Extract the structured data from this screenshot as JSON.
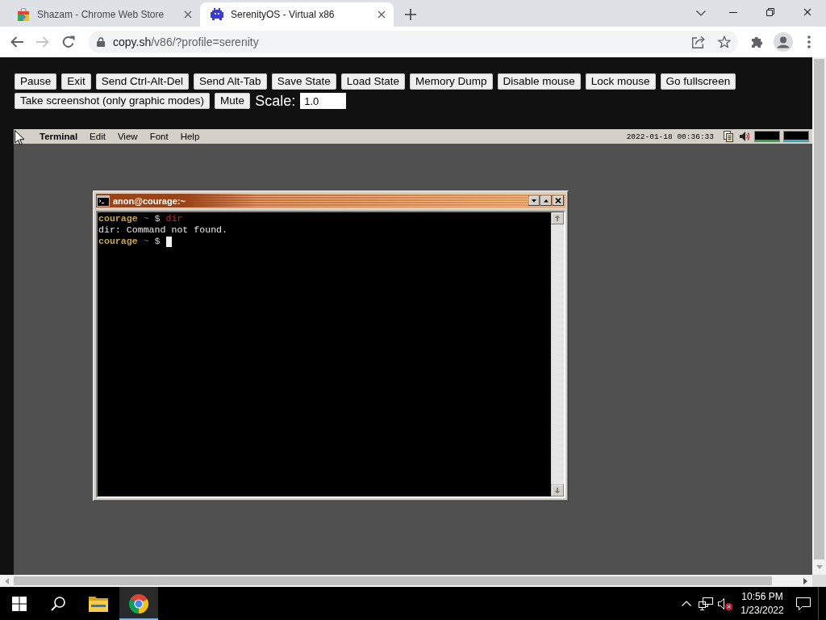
{
  "browser": {
    "tabs": [
      {
        "kind": "store",
        "title": "Shazam - Chrome Web Store",
        "selected": false
      },
      {
        "kind": "serenity",
        "title": "SerenityOS - Virtual x86",
        "selected": true
      }
    ],
    "toolbar": {
      "forward_disabled": true
    },
    "address": {
      "host": "copy.sh",
      "path": "/v86/?profile=serenity"
    }
  },
  "emulator_controls": {
    "buttons": [
      "Pause",
      "Exit",
      "Send Ctrl-Alt-Del",
      "Send Alt-Tab",
      "Save State",
      "Load State",
      "Memory Dump",
      "Disable mouse",
      "Lock mouse",
      "Go fullscreen",
      "Take screenshot (only graphic modes)",
      "Mute"
    ],
    "scale": {
      "label": "Scale:",
      "value": "1.0"
    }
  },
  "emulator": {
    "menubar": {
      "app": "Terminal",
      "menus": [
        "Edit",
        "View",
        "Font",
        "Help"
      ],
      "clock": "2022-01-18 00:36:33"
    },
    "terminal_window": {
      "title": "anon@courage:~",
      "lines": [
        {
          "segments": [
            {
              "kind": "host",
              "text": "courage"
            },
            {
              "kind": "path",
              "text": "~"
            },
            {
              "kind": "prompt",
              "text": "$"
            },
            {
              "kind": "command",
              "text": "dir"
            }
          ],
          "cursor": false
        },
        {
          "segments": [
            {
              "kind": "output",
              "text": "dir: Command not found."
            }
          ],
          "cursor": false
        },
        {
          "segments": [
            {
              "kind": "host",
              "text": "courage"
            },
            {
              "kind": "path",
              "text": "~"
            },
            {
              "kind": "prompt",
              "text": "$"
            }
          ],
          "cursor": true
        }
      ]
    }
  },
  "taskbar": {
    "apps": [
      {
        "kind": "explorer",
        "selected": false
      },
      {
        "kind": "chrome",
        "selected": true
      }
    ],
    "tray": {
      "volume_muted": true
    },
    "time": "10:56 PM",
    "date": "1/23/2022"
  }
}
